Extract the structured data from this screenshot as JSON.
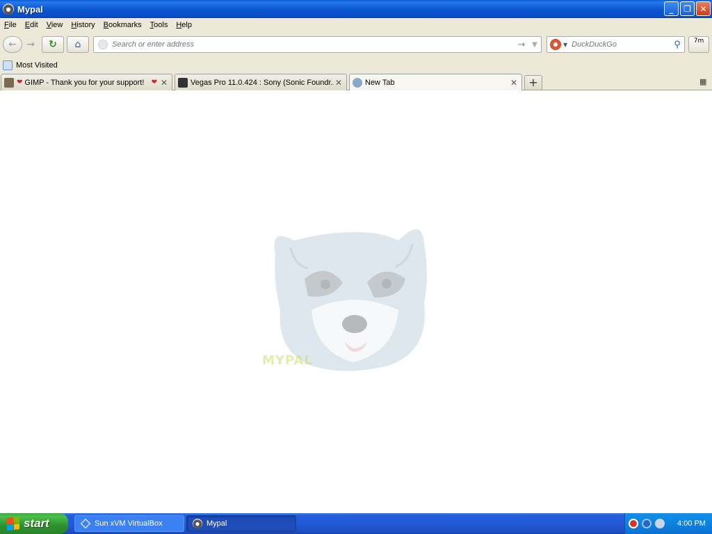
{
  "window": {
    "title": "Mypal",
    "buttons": {
      "minimize": "_",
      "maximize": "❐",
      "close": "✕"
    }
  },
  "menu": [
    "File",
    "Edit",
    "View",
    "History",
    "Bookmarks",
    "Tools",
    "Help"
  ],
  "nav": {
    "back_icon": "←",
    "forward_icon": "→",
    "reload_icon": "↻",
    "home_icon": "⌂",
    "url_placeholder": "Search or enter address",
    "url_value": "",
    "go_icon": "→",
    "dropdown_icon": "▼",
    "search_engine": "DuckDuckGo",
    "search_icon": "⚲",
    "zoom_label": "7m"
  },
  "bookmarks": {
    "most_visited": "Most Visited"
  },
  "tabs": [
    {
      "label": "GIMP - ",
      "label_suffix": "Thank you for your support!",
      "heart": "❤",
      "close": "✕",
      "favicon_color": "#7b6a4e"
    },
    {
      "label": "Vegas Pro 11.0.424 : Sony (Sonic Foundr...",
      "close": "✕",
      "favicon_color": "#333333"
    },
    {
      "label": "New Tab",
      "close": "✕",
      "favicon_color": "#8aa8c8",
      "active": true
    }
  ],
  "new_tab_icon": "+",
  "tab_list_icon": "▦",
  "watermark": "MYPAL",
  "taskbar": {
    "start_label": "start",
    "tasks": [
      {
        "label": "Sun xVM VirtualBox"
      },
      {
        "label": "Mypal",
        "active": true
      }
    ],
    "clock": "4:00 PM"
  },
  "colors": {
    "title_bar": "#0a5cd8",
    "chrome_bg": "#ece9d8",
    "taskbar": "#245edb",
    "start_green": "#3ea83e",
    "tray": "#0e82e0"
  }
}
